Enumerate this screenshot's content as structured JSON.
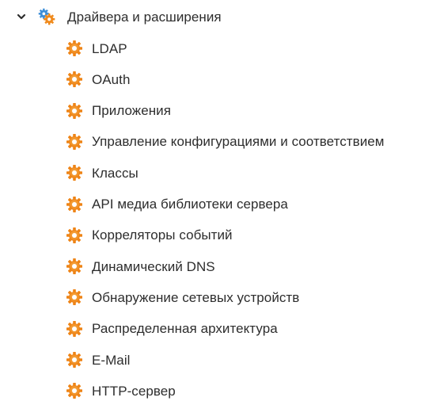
{
  "tree": {
    "parent": {
      "label": "Драйвера и расширения",
      "expanded": true,
      "icon": "gears-icon",
      "chevron_icon": "chevron-down-icon"
    },
    "children": [
      {
        "label": "LDAP",
        "icon": "gear-icon"
      },
      {
        "label": "OAuth",
        "icon": "gear-icon"
      },
      {
        "label": "Приложения",
        "icon": "gear-icon"
      },
      {
        "label": "Управление конфигурациями и соответствием",
        "icon": "gear-icon"
      },
      {
        "label": "Классы",
        "icon": "gear-icon"
      },
      {
        "label": "API медиа библиотеки сервера",
        "icon": "gear-icon"
      },
      {
        "label": "Корреляторы событий",
        "icon": "gear-icon"
      },
      {
        "label": "Динамический DNS",
        "icon": "gear-icon"
      },
      {
        "label": "Обнаружение сетевых устройств",
        "icon": "gear-icon"
      },
      {
        "label": "Распределенная архитектура",
        "icon": "gear-icon"
      },
      {
        "label": "E-Mail",
        "icon": "gear-icon"
      },
      {
        "label": "HTTP-сервер",
        "icon": "gear-icon"
      }
    ]
  },
  "colors": {
    "gear_orange": "#f08a1c",
    "gear_orange_light": "#f7a545",
    "gear_blue": "#3d8fd9",
    "text": "#2d2d2d"
  }
}
